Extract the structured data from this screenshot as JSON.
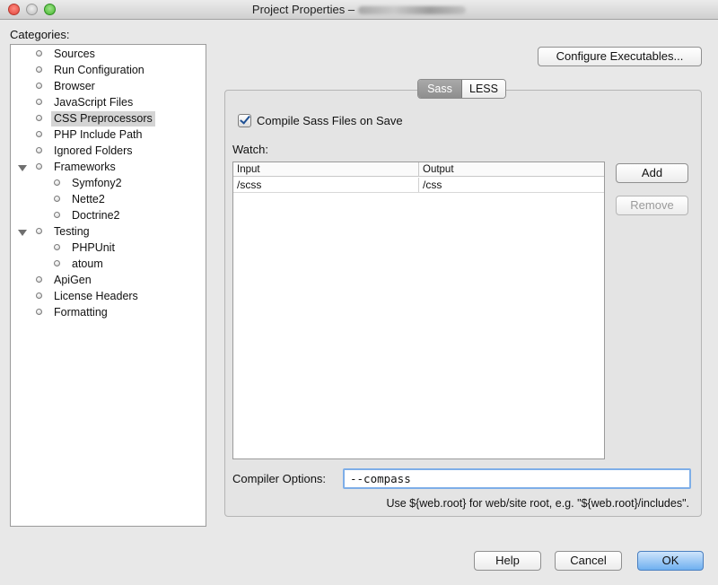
{
  "window": {
    "title": "Project Properties –"
  },
  "categories": {
    "label": "Categories:",
    "items": [
      {
        "label": "Sources"
      },
      {
        "label": "Run Configuration"
      },
      {
        "label": "Browser"
      },
      {
        "label": "JavaScript Files"
      },
      {
        "label": "CSS Preprocessors",
        "selected": true
      },
      {
        "label": "PHP Include Path"
      },
      {
        "label": "Ignored Folders"
      },
      {
        "label": "Frameworks",
        "expanded": true
      },
      {
        "label": "Symfony2"
      },
      {
        "label": "Nette2"
      },
      {
        "label": "Doctrine2"
      },
      {
        "label": "Testing",
        "expanded": true
      },
      {
        "label": "PHPUnit"
      },
      {
        "label": "atoum"
      },
      {
        "label": "ApiGen"
      },
      {
        "label": "License Headers"
      },
      {
        "label": "Formatting"
      }
    ]
  },
  "toolbar": {
    "configure_label": "Configure Executables..."
  },
  "tabs": {
    "sass_label": "Sass",
    "less_label": "LESS",
    "active": "Sass"
  },
  "sass": {
    "compile_on_save_label": "Compile Sass Files on Save",
    "compile_on_save_checked": true,
    "watch_label": "Watch:",
    "table": {
      "columns": [
        "Input",
        "Output"
      ],
      "rows": [
        {
          "input": "/scss",
          "output": "/css"
        }
      ]
    },
    "add_label": "Add",
    "remove_label": "Remove",
    "compiler_options_label": "Compiler Options:",
    "compiler_options_value": "--compass",
    "hint": "Use ${web.root} for web/site root, e.g. \"${web.root}/includes\"."
  },
  "footer": {
    "help_label": "Help",
    "cancel_label": "Cancel",
    "ok_label": "OK"
  },
  "colors": {
    "selection_bg": "#d4d4d4",
    "default_button": "#6fb0f0",
    "input_focus": "#7eaee8"
  }
}
